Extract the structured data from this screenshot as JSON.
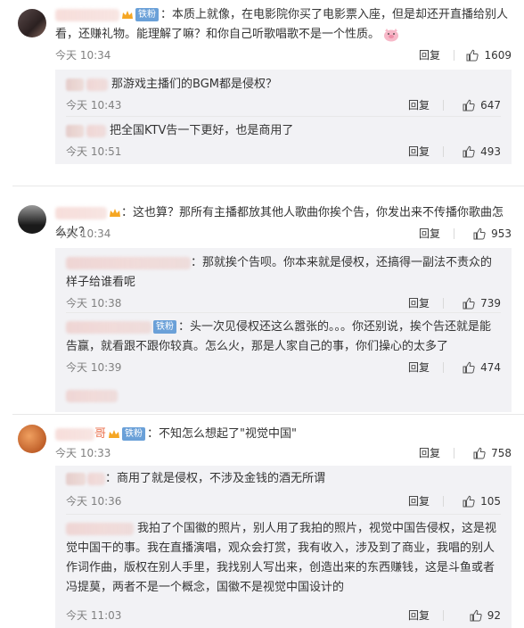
{
  "colors": {
    "accent": "#eb7350",
    "badge": "#6aa0d8",
    "sub_bg": "#f2f2f5"
  },
  "comments": [
    {
      "badge": "铁粉",
      "text": "：本质上就像，在电影院你买了电影票入座，但是却还开直播给别人看，还赚礼物。能理解了嘛？和你自己听歌唱歌不是一个性质。",
      "emoji": "pig-face-icon",
      "time": "今天 10:34",
      "reply": "回复",
      "likes": "1609",
      "replies": [
        {
          "text": "那游戏主播们的BGM都是侵权？",
          "time": "今天 10:43",
          "reply": "回复",
          "likes": "647"
        },
        {
          "text": "把全国KTV告一下更好，也是商用了",
          "time": "今天 10:51",
          "reply": "回复",
          "likes": "493"
        }
      ]
    },
    {
      "text": "：这也算？那所有主播都放其他人歌曲你挨个告，你发出来不传播你歌曲怎么火？",
      "time": "今天 10:34",
      "reply": "回复",
      "likes": "953",
      "replies": [
        {
          "text": "：那就挨个告呗。你本来就是侵权，还搞得一副法不责众的样子给谁看呢",
          "time": "今天 10:38",
          "reply": "回复",
          "likes": "739"
        },
        {
          "badge": "铁粉",
          "text": "：头一次见侵权还这么嚣张的。。。你还别说，挨个告还就是能告赢，就看跟不跟你较真。怎么火，那是人家自己的事，你们操心的太多了",
          "time": "今天 10:39",
          "reply": "回复",
          "likes": "474"
        }
      ]
    },
    {
      "name_tail": "哥",
      "badge": "铁粉",
      "text": "：不知怎么想起了\"视觉中国\"",
      "time": "今天 10:33",
      "reply": "回复",
      "likes": "758",
      "replies": [
        {
          "text": "：商用了就是侵权，不涉及金钱的酒无所谓",
          "time": "今天 10:36",
          "reply": "回复",
          "likes": "105"
        },
        {
          "text": "我拍了个国徽的照片，别人用了我拍的照片，视觉中国告侵权，这是视觉中国干的事。我在直播演唱，观众会打赏，我有收入，涉及到了商业，我唱的别人作词作曲，版权在别人手里，我找别人写出来，创造出来的东西赚钱，这是斗鱼或者冯提莫，两者不是一个概念，国徽不是视觉中国设计的",
          "time": "今天 11:03",
          "reply": "回复",
          "likes": "92"
        }
      ]
    }
  ]
}
